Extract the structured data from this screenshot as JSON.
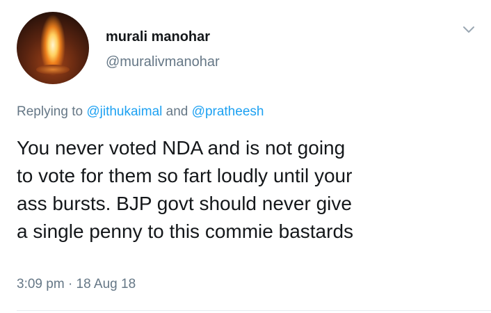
{
  "user": {
    "display_name": "murali manohar",
    "handle": "@muralivmanohar",
    "avatar_icon": "oil-lamp-flame-avatar"
  },
  "reply": {
    "prefix": "Replying to",
    "mention1": "@jithukaimal",
    "conjunction": "and",
    "mention2": "@pratheesh"
  },
  "tweet": {
    "lines": [
      "You never voted NDA and is not going",
      "to vote for them so fart loudly until your",
      "ass bursts. BJP govt should never give",
      "a single penny to this commie bastards"
    ]
  },
  "meta": {
    "time": "3:09 pm",
    "separator": "·",
    "date": "18 Aug 18"
  },
  "colors": {
    "text": "#14171a",
    "secondary": "#657786",
    "link": "#1da1f2"
  },
  "icons": {
    "menu": "chevron-down-icon"
  }
}
